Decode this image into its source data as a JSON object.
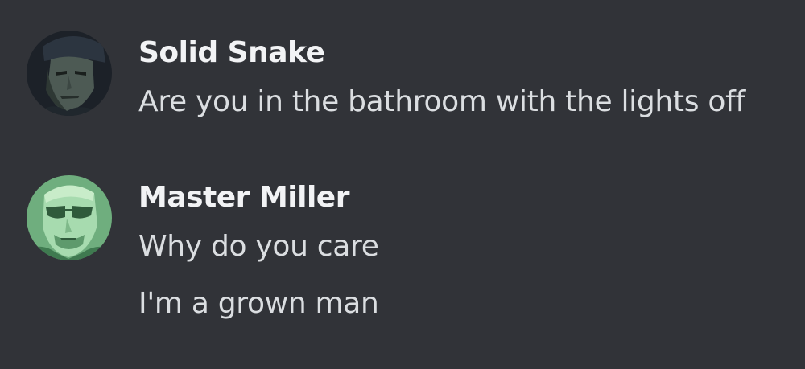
{
  "colors": {
    "background": "#313338",
    "author_name": "#f2f3f5",
    "message_text": "#dbdee1"
  },
  "messages": [
    {
      "author": "Solid Snake",
      "avatar_icon": "solid-snake-avatar",
      "lines": [
        "Are you in the bathroom with the lights off"
      ]
    },
    {
      "author": "Master Miller",
      "avatar_icon": "master-miller-avatar",
      "lines": [
        "Why do you care",
        "I'm a grown man"
      ]
    }
  ]
}
